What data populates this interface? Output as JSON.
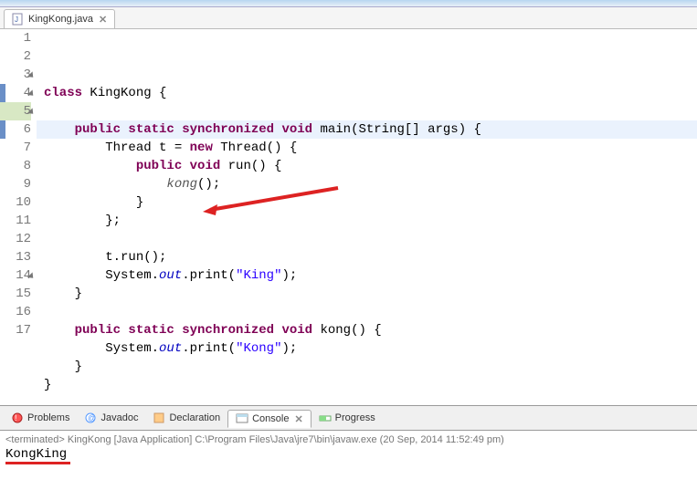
{
  "tab": {
    "filename": "KingKong.java"
  },
  "code": {
    "lines": [
      {
        "n": "1",
        "tokens": [
          {
            "t": "kw",
            "v": "class"
          },
          {
            "t": "txt",
            "v": " KingKong {"
          }
        ]
      },
      {
        "n": "2",
        "tokens": []
      },
      {
        "n": "3",
        "expandable": true,
        "tokens": [
          {
            "t": "txt",
            "v": "    "
          },
          {
            "t": "kw",
            "v": "public static synchronized void"
          },
          {
            "t": "txt",
            "v": " main(String[] args) {"
          }
        ]
      },
      {
        "n": "4",
        "expandable": true,
        "tokens": [
          {
            "t": "txt",
            "v": "        Thread t = "
          },
          {
            "t": "kw",
            "v": "new"
          },
          {
            "t": "txt",
            "v": " Thread() {"
          }
        ]
      },
      {
        "n": "5",
        "expandable": true,
        "highlight": true,
        "tokens": [
          {
            "t": "txt",
            "v": "            "
          },
          {
            "t": "kw",
            "v": "public void"
          },
          {
            "t": "txt",
            "v": " run() {"
          }
        ]
      },
      {
        "n": "6",
        "current": true,
        "tokens": [
          {
            "t": "txt",
            "v": "                "
          },
          {
            "t": "ital",
            "v": "kong"
          },
          {
            "t": "txt",
            "v": "();"
          }
        ]
      },
      {
        "n": "7",
        "tokens": [
          {
            "t": "txt",
            "v": "            }"
          }
        ]
      },
      {
        "n": "8",
        "tokens": [
          {
            "t": "txt",
            "v": "        };"
          }
        ]
      },
      {
        "n": "9",
        "tokens": []
      },
      {
        "n": "10",
        "tokens": [
          {
            "t": "txt",
            "v": "        t.run();"
          }
        ]
      },
      {
        "n": "11",
        "tokens": [
          {
            "t": "txt",
            "v": "        System."
          },
          {
            "t": "field",
            "v": "out"
          },
          {
            "t": "txt",
            "v": ".print("
          },
          {
            "t": "str",
            "v": "\"King\""
          },
          {
            "t": "txt",
            "v": ");"
          }
        ]
      },
      {
        "n": "12",
        "tokens": [
          {
            "t": "txt",
            "v": "    }"
          }
        ]
      },
      {
        "n": "13",
        "tokens": []
      },
      {
        "n": "14",
        "expandable": true,
        "tokens": [
          {
            "t": "txt",
            "v": "    "
          },
          {
            "t": "kw",
            "v": "public static synchronized void"
          },
          {
            "t": "txt",
            "v": " kong() {"
          }
        ]
      },
      {
        "n": "15",
        "tokens": [
          {
            "t": "txt",
            "v": "        System."
          },
          {
            "t": "field",
            "v": "out"
          },
          {
            "t": "txt",
            "v": ".print("
          },
          {
            "t": "str",
            "v": "\"Kong\""
          },
          {
            "t": "txt",
            "v": ");"
          }
        ]
      },
      {
        "n": "16",
        "tokens": [
          {
            "t": "txt",
            "v": "    }"
          }
        ]
      },
      {
        "n": "17",
        "tokens": [
          {
            "t": "txt",
            "v": "}"
          }
        ]
      }
    ]
  },
  "bottom_tabs": {
    "problems": "Problems",
    "javadoc": "Javadoc",
    "declaration": "Declaration",
    "console": "Console",
    "progress": "Progress"
  },
  "console": {
    "header_prefix": "<terminated>",
    "header_rest": " KingKong [Java Application] C:\\Program Files\\Java\\jre7\\bin\\javaw.exe (20 Sep, 2014 11:52:49 pm)",
    "output": "KongKing"
  }
}
